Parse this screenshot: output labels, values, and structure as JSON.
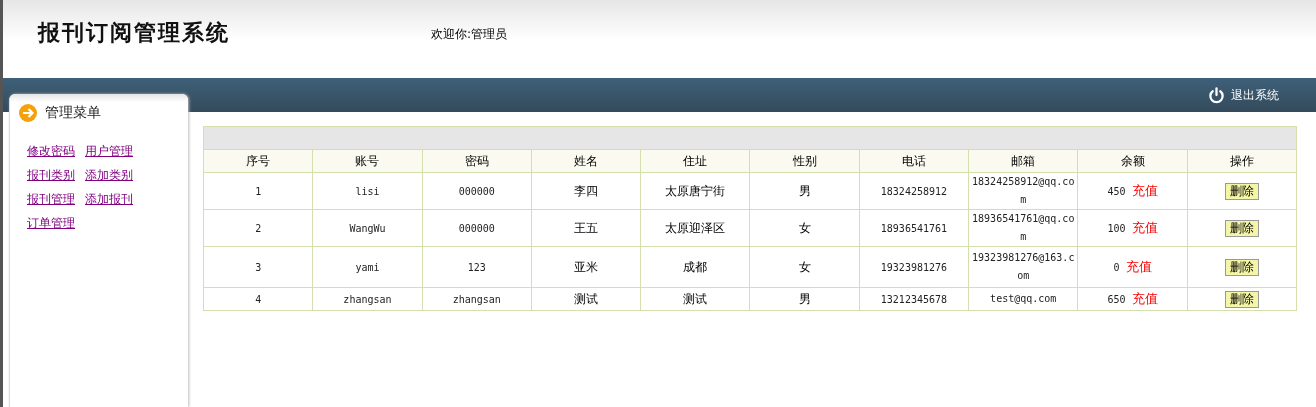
{
  "header": {
    "title": "报刊订阅管理系统",
    "welcome": "欢迎你:管理员"
  },
  "nav_bar": {
    "logout": "退出系统"
  },
  "sidebar": {
    "title": "管理菜单",
    "items": [
      "修改密码",
      "用户管理",
      "报刊类别",
      "添加类别",
      "报刊管理",
      "添加报刊",
      "订单管理"
    ]
  },
  "table": {
    "columns": [
      "序号",
      "账号",
      "密码",
      "姓名",
      "住址",
      "性别",
      "电话",
      "邮箱",
      "余额",
      "操作"
    ],
    "rows": [
      {
        "no": "1",
        "account": "lisi",
        "password": "000000",
        "name": "李四",
        "address": "太原唐宁街",
        "gender": "男",
        "phone": "18324258912",
        "email": "18324258912@qq.com",
        "balance": "450",
        "recharge": "充值",
        "delete": "删除"
      },
      {
        "no": "2",
        "account": "WangWu",
        "password": "000000",
        "name": "王五",
        "address": "太原迎泽区",
        "gender": "女",
        "phone": "18936541761",
        "email": "18936541761@qq.com",
        "balance": "100",
        "recharge": "充值",
        "delete": "删除"
      },
      {
        "no": "3",
        "account": "yami",
        "password": "123",
        "name": "亚米",
        "address": "成都",
        "gender": "女",
        "phone": "19323981276",
        "email": "19323981276@163.com",
        "balance": "0",
        "recharge": "充值",
        "delete": "删除"
      },
      {
        "no": "4",
        "account": "zhangsan",
        "password": "zhangsan",
        "name": "测试",
        "address": "测试",
        "gender": "男",
        "phone": "13212345678",
        "email": "test@qq.com",
        "balance": "650",
        "recharge": "充值",
        "delete": "删除"
      }
    ]
  }
}
